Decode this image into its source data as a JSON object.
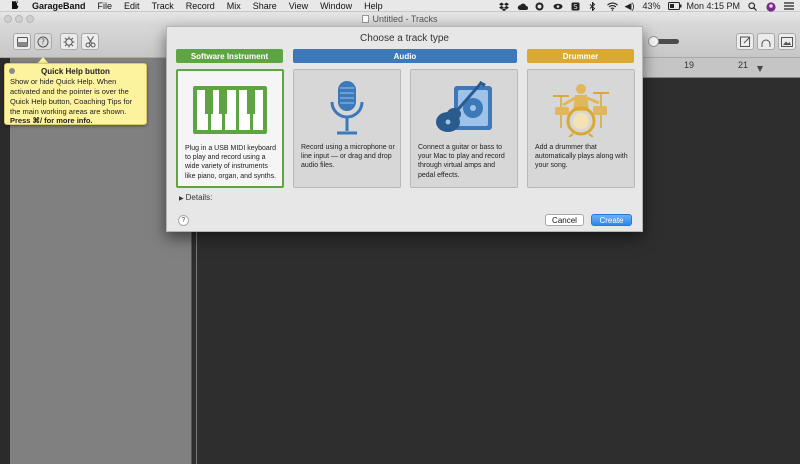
{
  "menubar": {
    "items": [
      "GarageBand",
      "File",
      "Edit",
      "Track",
      "Record",
      "Mix",
      "Share",
      "View",
      "Window",
      "Help"
    ],
    "battery": "43%",
    "clock": "Mon 4:15 PM"
  },
  "window": {
    "title": "Untitled - Tracks"
  },
  "ruler": {
    "marks": [
      "19",
      "21"
    ]
  },
  "tooltip": {
    "title": "Quick Help button",
    "body": "Show or hide Quick Help. When activated and the pointer is over the Quick Help button, Coaching Tips for the main working areas are shown.",
    "footer": "Press ⌘/ for more info."
  },
  "dialog": {
    "title": "Choose a track type",
    "categories": [
      {
        "label": "Software Instrument",
        "color": "#5fa443"
      },
      {
        "label": "Audio",
        "color": "#3d78b8"
      },
      {
        "label": "Drummer",
        "color": "#d9a933"
      }
    ],
    "cards": [
      {
        "icon": "piano-keyboard-icon",
        "desc": "Plug in a USB MIDI keyboard to play and record using a wide variety of instruments like piano, organ, and synths."
      },
      {
        "icon": "microphone-icon",
        "desc": "Record using a microphone or line input — or drag and drop audio files."
      },
      {
        "icon": "guitar-amp-icon",
        "desc": "Connect a guitar or bass to your Mac to play and record through virtual amps and pedal effects."
      },
      {
        "icon": "drummer-icon",
        "desc": "Add a drummer that automatically plays along with your song."
      }
    ],
    "details_label": "Details:",
    "help_label": "?",
    "cancel_label": "Cancel",
    "create_label": "Create"
  }
}
